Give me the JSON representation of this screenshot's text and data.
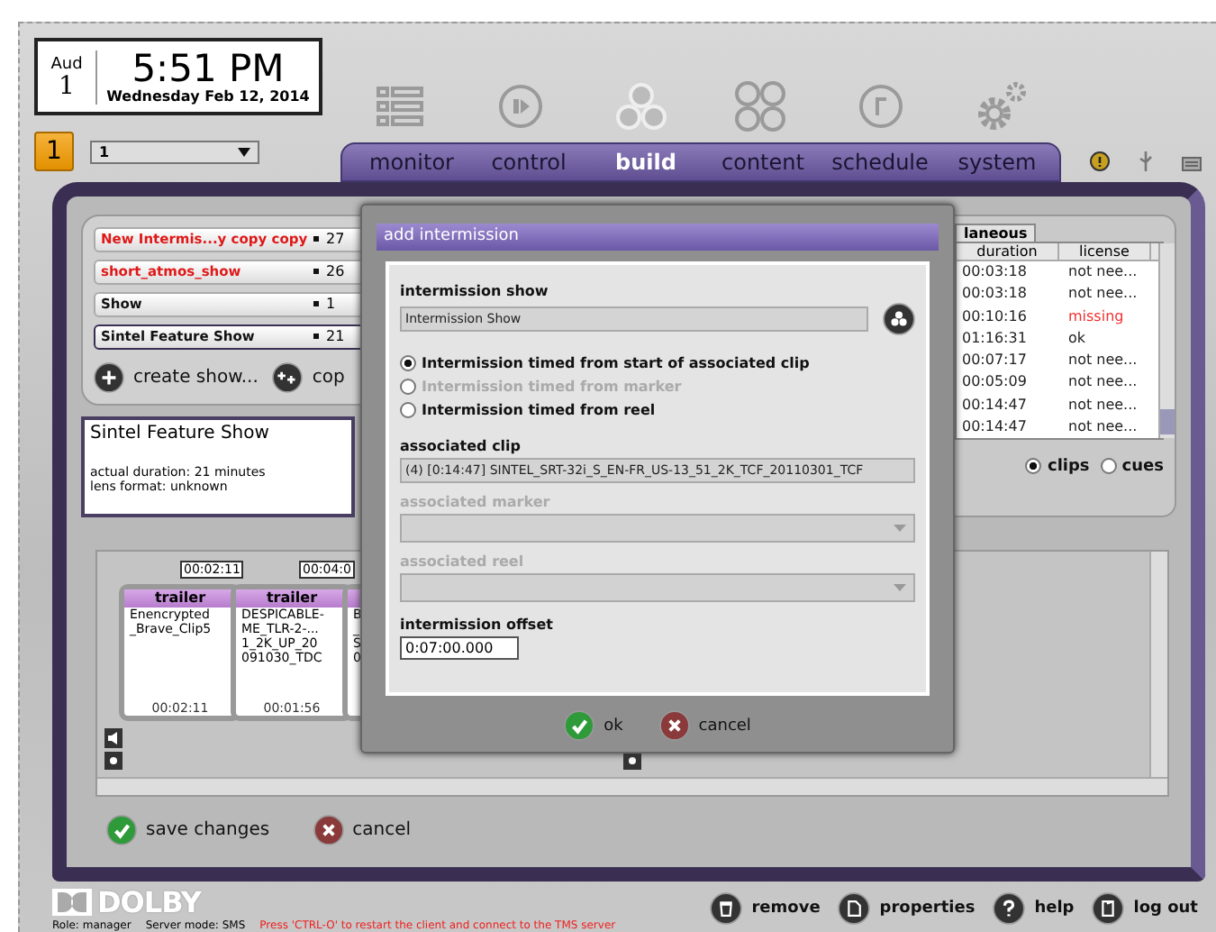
{
  "clock": {
    "auditorium_label": "Aud",
    "auditorium": "1",
    "time": "5:51 PM",
    "date": "Wednesday Feb 12, 2014"
  },
  "auditorium_badge": "1",
  "auditorium_select": {
    "value": "1"
  },
  "nav_tabs": [
    {
      "label": "monitor",
      "kind": "list",
      "selected": false
    },
    {
      "label": "control",
      "kind": "play",
      "selected": false
    },
    {
      "label": "build",
      "kind": "build",
      "selected": true
    },
    {
      "label": "content",
      "kind": "content",
      "selected": false
    },
    {
      "label": "schedule",
      "kind": "schedule",
      "selected": false
    },
    {
      "label": "system",
      "kind": "system",
      "selected": false
    }
  ],
  "shows": [
    {
      "name": "New Intermis...y copy copy",
      "duration": "27",
      "error": true,
      "selected": false
    },
    {
      "name": "short_atmos_show",
      "duration": "26",
      "error": true,
      "selected": false
    },
    {
      "name": "Show",
      "duration": "1",
      "error": false,
      "selected": false
    },
    {
      "name": "Sintel Feature Show",
      "duration": "21",
      "error": false,
      "selected": true
    }
  ],
  "show_actions": [
    {
      "label": "create show...",
      "kind": "plus"
    },
    {
      "label": "cop",
      "kind": "copy"
    }
  ],
  "show_info": {
    "title": "Sintel Feature Show",
    "lines": [
      "actual duration: 21 minutes",
      "lens format: unknown"
    ]
  },
  "clip_panel": {
    "tab": "laneous",
    "columns": [
      "duration",
      "license"
    ],
    "rows": [
      {
        "duration": "00:03:18",
        "license": "not nee...",
        "warning": false
      },
      {
        "duration": "00:03:18",
        "license": "not nee...",
        "warning": false
      },
      {
        "duration": "00:10:16",
        "license": "missing",
        "warning": true
      },
      {
        "duration": "01:16:31",
        "license": "ok",
        "warning": false
      },
      {
        "duration": "00:07:17",
        "license": "not nee...",
        "warning": false
      },
      {
        "duration": "00:05:09",
        "license": "not nee...",
        "warning": false
      },
      {
        "duration": "00:14:47",
        "license": "not nee...",
        "warning": false
      },
      {
        "duration": "00:14:47",
        "license": "not nee...",
        "warning": false
      }
    ]
  },
  "clip_filter": [
    {
      "label": "clips",
      "selected": true
    },
    {
      "label": "cues",
      "selected": false
    }
  ],
  "timeline": {
    "markers": [
      "00:02:11",
      "00:04:0"
    ],
    "clips": [
      {
        "type": "trailer",
        "lines": [
          "Enencrypted",
          "_Brave_Clip5"
        ],
        "duration": "00:02:11"
      },
      {
        "type": "trailer",
        "lines": [
          "DESPICABLE-",
          "ME_TLR-2-...",
          "1_2K_UP_20",
          "091030_TDC"
        ],
        "duration": "00:01:56"
      },
      {
        "lines": [
          "B",
          "_",
          "S",
          "0"
        ]
      }
    ]
  },
  "timeline_actions": [
    {
      "label": "save changes",
      "kind": "ok"
    },
    {
      "label": "cancel",
      "kind": "cancel"
    }
  ],
  "footer": {
    "logo": "DOLBY",
    "role": "Role: manager",
    "server_mode": "Server mode: SMS",
    "notice": "Press 'CTRL-O' to restart the client and connect to the TMS server",
    "buttons": [
      {
        "label": "remove",
        "kind": "trash"
      },
      {
        "label": "properties",
        "kind": "page"
      },
      {
        "label": "help",
        "kind": "help"
      },
      {
        "label": "log out",
        "kind": "door"
      }
    ]
  },
  "dialog": {
    "title": "add intermission",
    "show_label": "intermission show",
    "show_value": "Intermission Show",
    "timing": [
      {
        "label": "Intermission timed from start of associated clip",
        "selected": true,
        "disabled": false
      },
      {
        "label": "Intermission timed from marker",
        "selected": false,
        "disabled": true
      },
      {
        "label": "Intermission timed from reel",
        "selected": false,
        "disabled": false
      }
    ],
    "clip_label": "associated clip",
    "clip_value": "(4) [0:14:47] SINTEL_SRT-32i_S_EN-FR_US-13_51_2K_TCF_20110301_TCF",
    "selects": [
      {
        "label": "associated marker",
        "disabled": true
      },
      {
        "label": "associated reel",
        "disabled": true
      }
    ],
    "offset_label": "intermission offset",
    "offset_value": "0:07:00.000",
    "buttons": [
      {
        "label": "ok",
        "kind": "ok"
      },
      {
        "label": "cancel",
        "kind": "cancel"
      }
    ]
  }
}
